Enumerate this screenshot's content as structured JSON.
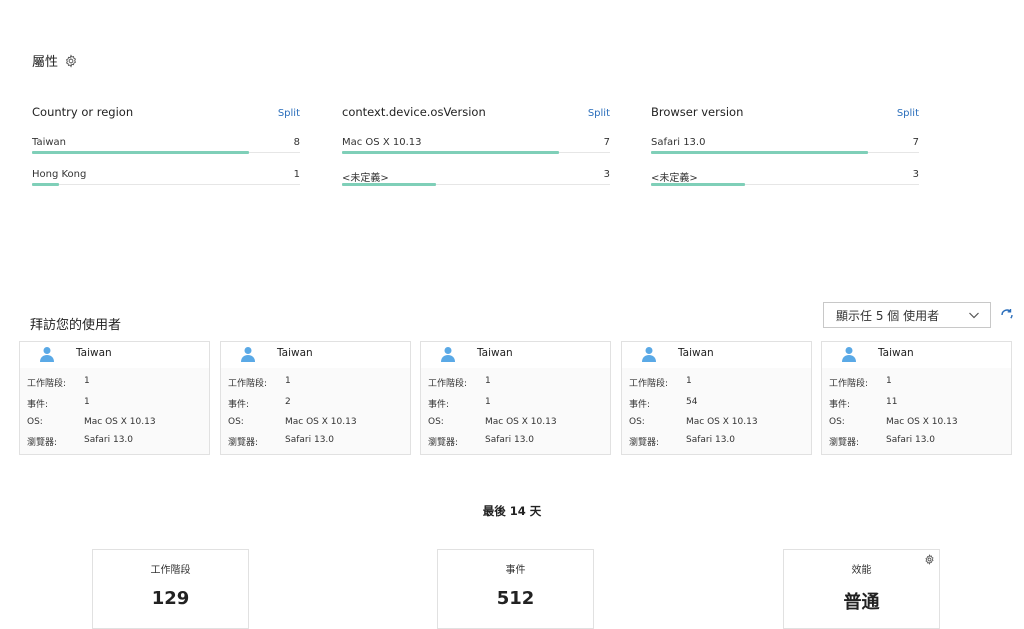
{
  "properties": {
    "title": "屬性",
    "columns": [
      {
        "title": "Country or region",
        "split_label": "Split",
        "rows": [
          {
            "label": "Taiwan",
            "count": "8",
            "fraction": 0.81
          },
          {
            "label": "Hong Kong",
            "count": "1",
            "fraction": 0.1
          }
        ]
      },
      {
        "title": "context.device.osVersion",
        "split_label": "Split",
        "rows": [
          {
            "label": "Mac OS X 10.13",
            "count": "7",
            "fraction": 0.81
          },
          {
            "label": "<未定義>",
            "count": "3",
            "fraction": 0.35
          }
        ]
      },
      {
        "title": "Browser version",
        "split_label": "Split",
        "rows": [
          {
            "label": "Safari 13.0",
            "count": "7",
            "fraction": 0.81
          },
          {
            "label": "<未定義>",
            "count": "3",
            "fraction": 0.35
          }
        ]
      }
    ]
  },
  "users": {
    "title": "拜訪您的使用者",
    "dropdown_value": "顯示任 5 個 使用者",
    "field_labels": {
      "sessions": "工作階段:",
      "events": "事件:",
      "os": "OS:",
      "browser": "瀏覽器:"
    },
    "cards": [
      {
        "name": "Taiwan",
        "sessions": "1",
        "events": "1",
        "os": "Mac OS X 10.13",
        "browser": "Safari 13.0"
      },
      {
        "name": "Taiwan",
        "sessions": "1",
        "events": "2",
        "os": "Mac OS X 10.13",
        "browser": "Safari 13.0"
      },
      {
        "name": "Taiwan",
        "sessions": "1",
        "events": "1",
        "os": "Mac OS X 10.13",
        "browser": "Safari 13.0"
      },
      {
        "name": "Taiwan",
        "sessions": "1",
        "events": "54",
        "os": "Mac OS X 10.13",
        "browser": "Safari 13.0"
      },
      {
        "name": "Taiwan",
        "sessions": "1",
        "events": "11",
        "os": "Mac OS X 10.13",
        "browser": "Safari 13.0"
      }
    ]
  },
  "summary": {
    "title": "最後 14 天",
    "kpis": [
      {
        "label": "工作階段",
        "value": "129"
      },
      {
        "label": "事件",
        "value": "512"
      },
      {
        "label": "效能",
        "value": "普通"
      }
    ]
  },
  "colors": {
    "accent_bar": "#7fcfb8",
    "link": "#2a6ebb",
    "user_icon": "#5aa9e6"
  },
  "icons": {
    "settings": "gear-icon",
    "user": "user-icon",
    "dropdown": "chevron-down-icon",
    "refresh": "refresh-icon"
  }
}
